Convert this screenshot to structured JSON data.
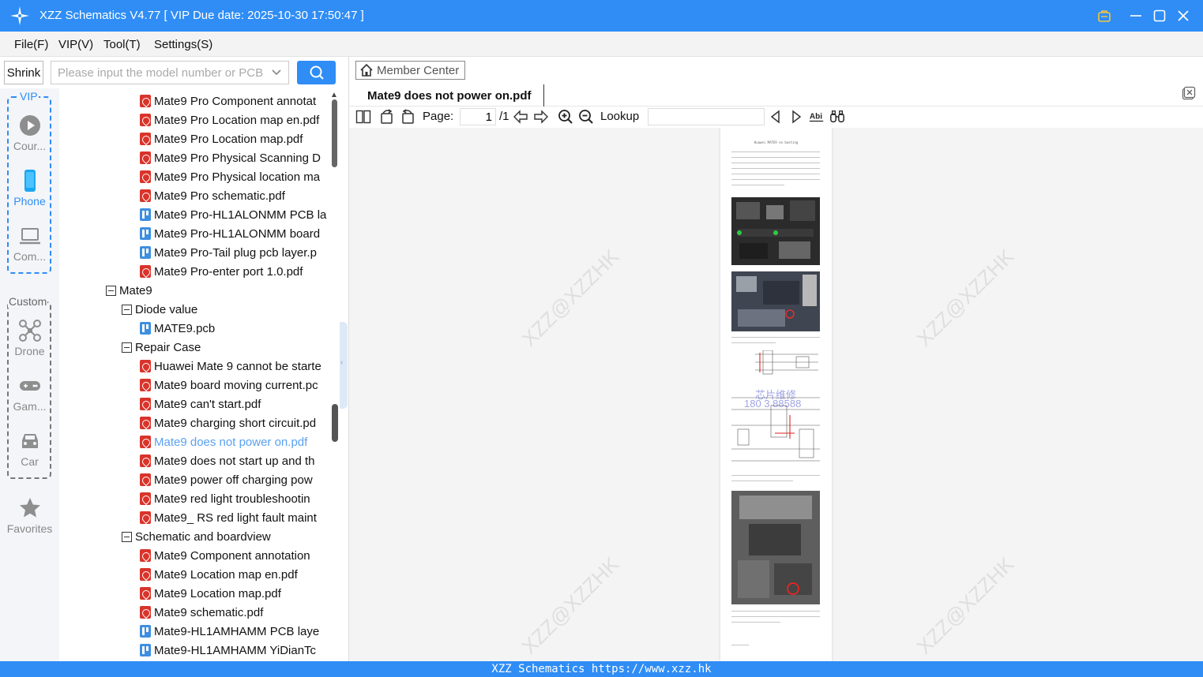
{
  "titlebar": {
    "title": "XZZ Schematics V4.77 [ VIP Due date: 2025-10-30 17:50:47 ]",
    "icons": [
      "app-logo-icon",
      "vip-badge-icon",
      "minimize-icon",
      "maximize-icon",
      "close-icon"
    ]
  },
  "menu": {
    "file": "File(F)",
    "vip": "VIP(V)",
    "tool": "Tool(T)",
    "settings": "Settings(S)"
  },
  "toolbar": {
    "shrink_label": "Shrink",
    "search_placeholder": "Please input the model number or PCB"
  },
  "rail": {
    "vip_label": "VIP",
    "custom_label": "Custom",
    "items": [
      {
        "label": "Cour...",
        "icon": "play-circle-icon"
      },
      {
        "label": "Phone",
        "icon": "phone-icon",
        "active": true
      },
      {
        "label": "Com...",
        "icon": "laptop-icon"
      },
      {
        "label": "Drone",
        "icon": "drone-icon"
      },
      {
        "label": "Gam...",
        "icon": "gamepad-icon"
      },
      {
        "label": "Car",
        "icon": "car-icon"
      },
      {
        "label": "Favorites",
        "icon": "star-icon"
      }
    ]
  },
  "tree": {
    "rows": [
      {
        "label": "Mate9 Pro Component annotat",
        "type": "pdf",
        "level": 3
      },
      {
        "label": "Mate9 Pro Location map en.pdf",
        "type": "pdf",
        "level": 3
      },
      {
        "label": "Mate9 Pro Location map.pdf",
        "type": "pdf",
        "level": 3
      },
      {
        "label": "Mate9 Pro Physical Scanning D",
        "type": "pdf",
        "level": 3
      },
      {
        "label": "Mate9 Pro Physical location ma",
        "type": "pdf",
        "level": 3
      },
      {
        "label": "Mate9 Pro schematic.pdf",
        "type": "pdf",
        "level": 3
      },
      {
        "label": "Mate9 Pro-HL1ALONMM PCB la",
        "type": "pcb",
        "level": 3
      },
      {
        "label": "Mate9 Pro-HL1ALONMM board",
        "type": "pcb",
        "level": 3
      },
      {
        "label": "Mate9 Pro-Tail plug pcb layer.p",
        "type": "pcb",
        "level": 3
      },
      {
        "label": "Mate9 Pro-enter port 1.0.pdf",
        "type": "pdf",
        "level": 3
      },
      {
        "label": "Mate9",
        "type": "folder",
        "level": 1
      },
      {
        "label": "Diode value",
        "type": "folder",
        "level": 2
      },
      {
        "label": "MATE9.pcb",
        "type": "pcb",
        "level": 3
      },
      {
        "label": "Repair Case",
        "type": "folder",
        "level": 2
      },
      {
        "label": "Huawei Mate 9 cannot be starte",
        "type": "pdf",
        "level": 3
      },
      {
        "label": "Mate9 board moving current.pc",
        "type": "pdf",
        "level": 3
      },
      {
        "label": "Mate9 can't start.pdf",
        "type": "pdf",
        "level": 3
      },
      {
        "label": "Mate9 charging short circuit.pd",
        "type": "pdf",
        "level": 3
      },
      {
        "label": "Mate9 does not power on.pdf",
        "type": "pdf",
        "level": 3,
        "selected": true
      },
      {
        "label": "Mate9 does not start up and th",
        "type": "pdf",
        "level": 3
      },
      {
        "label": "Mate9 power off charging pow",
        "type": "pdf",
        "level": 3
      },
      {
        "label": "Mate9 red light troubleshootin",
        "type": "pdf",
        "level": 3
      },
      {
        "label": "Mate9_ RS red light fault maint",
        "type": "pdf",
        "level": 3
      },
      {
        "label": "Schematic and boardview",
        "type": "folder",
        "level": 2
      },
      {
        "label": "Mate9 Component annotation",
        "type": "pdf",
        "level": 3
      },
      {
        "label": "Mate9 Location map en.pdf",
        "type": "pdf",
        "level": 3
      },
      {
        "label": "Mate9 Location map.pdf",
        "type": "pdf",
        "level": 3
      },
      {
        "label": "Mate9 schematic.pdf",
        "type": "pdf",
        "level": 3
      },
      {
        "label": "Mate9-HL1AMHAMM PCB laye",
        "type": "pcb",
        "level": 3
      },
      {
        "label": "Mate9-HL1AMHAMM YiDianTc",
        "type": "pcb",
        "level": 3
      }
    ]
  },
  "viewer": {
    "member_center": "Member Center",
    "tab_title": "Mate9 does not power on.pdf",
    "page_label": "Page:",
    "page_current": "1",
    "page_total": "/1",
    "lookup_label": "Lookup",
    "lookup_value": "",
    "page_heading": "Huawei MATE9 no booting",
    "watermark": "XZZ@XZZHK",
    "stamp_line1": "芯片维修",
    "stamp_line2": "180 3 88588"
  },
  "statusbar": {
    "text": "XZZ Schematics https://www.xzz.hk"
  },
  "colors": {
    "accent": "#2f8df5",
    "pdf_icon": "#d9342b",
    "pcb_icon": "#3d8fe0",
    "selected_text": "#5aa0f0"
  }
}
